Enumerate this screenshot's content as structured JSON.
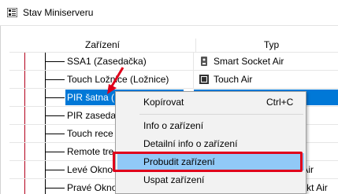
{
  "window": {
    "title": "Stav Miniserveru",
    "icon": "app-grid-icon"
  },
  "columns": {
    "device": "Zařízení",
    "type": "Typ"
  },
  "rows": [
    {
      "device": "SSA1 (Zasedačka)",
      "type": "Smart Socket Air",
      "icon": "socket-icon"
    },
    {
      "device": "Touch Ložnice (Ložnice)",
      "type": "Touch Air",
      "icon": "touch-icon"
    },
    {
      "device": "PIR šatna (",
      "type": "",
      "icon": ""
    },
    {
      "device": "PIR zasedač",
      "type": "",
      "icon": ""
    },
    {
      "device": "Touch rece",
      "type": "",
      "icon": ""
    },
    {
      "device": "Remote tre",
      "type": "",
      "icon": ""
    },
    {
      "device": "Levé Okno",
      "type": "kontakt Air",
      "icon": ""
    },
    {
      "device": "Pravé Okno (Obývací pokoj)",
      "type": "Okenní a dveřní kontakt Air",
      "icon": "contact-icon"
    }
  ],
  "context_menu": {
    "items": [
      {
        "label": "Kopírovat",
        "shortcut": "Ctrl+C"
      },
      {
        "label": "Info o zařízení",
        "shortcut": ""
      },
      {
        "label": "Detailní info o zařízení",
        "shortcut": ""
      },
      {
        "label": "Probudit zařízení",
        "shortcut": ""
      },
      {
        "label": "Uspat zařízení",
        "shortcut": ""
      }
    ],
    "highlighted_index": 3
  },
  "colors": {
    "selection": "#0078d7",
    "menu_highlight": "#91c9f7",
    "annotation_red": "#e0001b"
  }
}
